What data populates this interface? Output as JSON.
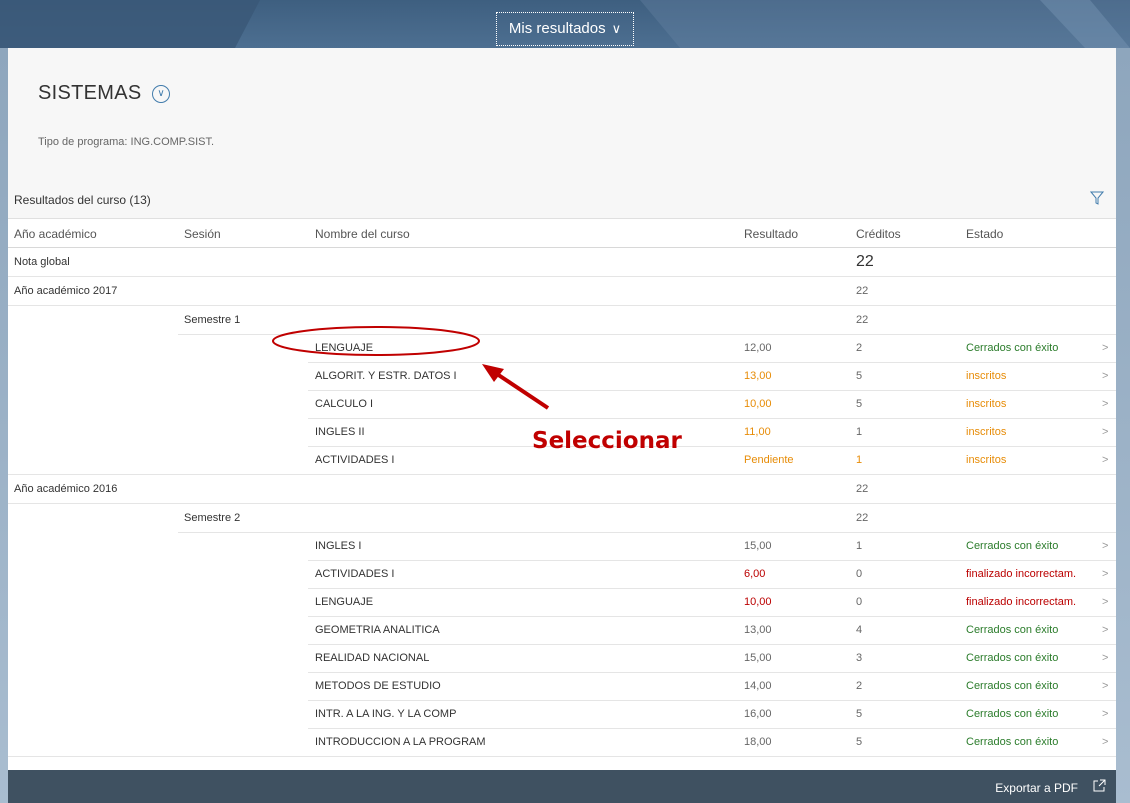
{
  "topbar": {
    "menu_label": "Mis resultados"
  },
  "program": {
    "title": "SISTEMAS",
    "subtitle": "Tipo de programa: ING.COMP.SIST."
  },
  "results": {
    "title": "Resultados del curso (13)",
    "columns": [
      "Año académico",
      "Sesión",
      "Nombre del curso",
      "Resultado",
      "Créditos",
      "Estado"
    ]
  },
  "rows": {
    "global": {
      "label": "Nota global",
      "credits": "22"
    },
    "y2017": {
      "label": "Año académico 2017",
      "credits": "22"
    },
    "s1": {
      "label": "Semestre 1",
      "credits": "22"
    },
    "r1": {
      "name": "LENGUAJE",
      "result": "12,00",
      "credits": "2",
      "state": "Cerrados con éxito"
    },
    "r2": {
      "name": "ALGORIT. Y ESTR. DATOS I",
      "result": "13,00",
      "credits": "5",
      "state": "inscritos"
    },
    "r3": {
      "name": "CALCULO I",
      "result": "10,00",
      "credits": "5",
      "state": "inscritos"
    },
    "r4": {
      "name": "INGLES II",
      "result": "11,00",
      "credits": "1",
      "state": "inscritos"
    },
    "r5": {
      "name": "ACTIVIDADES I",
      "result": "Pendiente",
      "credits": "1",
      "state": "inscritos"
    },
    "y2016": {
      "label": "Año académico 2016",
      "credits": "22"
    },
    "s2": {
      "label": "Semestre 2",
      "credits": "22"
    },
    "r6": {
      "name": "INGLES I",
      "result": "15,00",
      "credits": "1",
      "state": "Cerrados con éxito"
    },
    "r7": {
      "name": "ACTIVIDADES I",
      "result": "6,00",
      "credits": "0",
      "state": "finalizado incorrectam."
    },
    "r8": {
      "name": "LENGUAJE",
      "result": "10,00",
      "credits": "0",
      "state": "finalizado incorrectam."
    },
    "r9": {
      "name": "GEOMETRIA ANALITICA",
      "result": "13,00",
      "credits": "4",
      "state": "Cerrados con éxito"
    },
    "r10": {
      "name": "REALIDAD NACIONAL",
      "result": "15,00",
      "credits": "3",
      "state": "Cerrados con éxito"
    },
    "r11": {
      "name": "METODOS DE ESTUDIO",
      "result": "14,00",
      "credits": "2",
      "state": "Cerrados con éxito"
    },
    "r12": {
      "name": "INTR. A LA ING. Y LA COMP",
      "result": "16,00",
      "credits": "5",
      "state": "Cerrados con éxito"
    },
    "r13": {
      "name": "INTRODUCCION A LA PROGRAM",
      "result": "18,00",
      "credits": "5",
      "state": "Cerrados con éxito"
    }
  },
  "footer": {
    "export_label": "Exportar a PDF"
  },
  "annotation": {
    "label": "Seleccionar"
  },
  "colors": {
    "green": "#2b7c2b",
    "orange": "#e78c07",
    "red": "#bb0000",
    "annotation": "#c00000"
  }
}
